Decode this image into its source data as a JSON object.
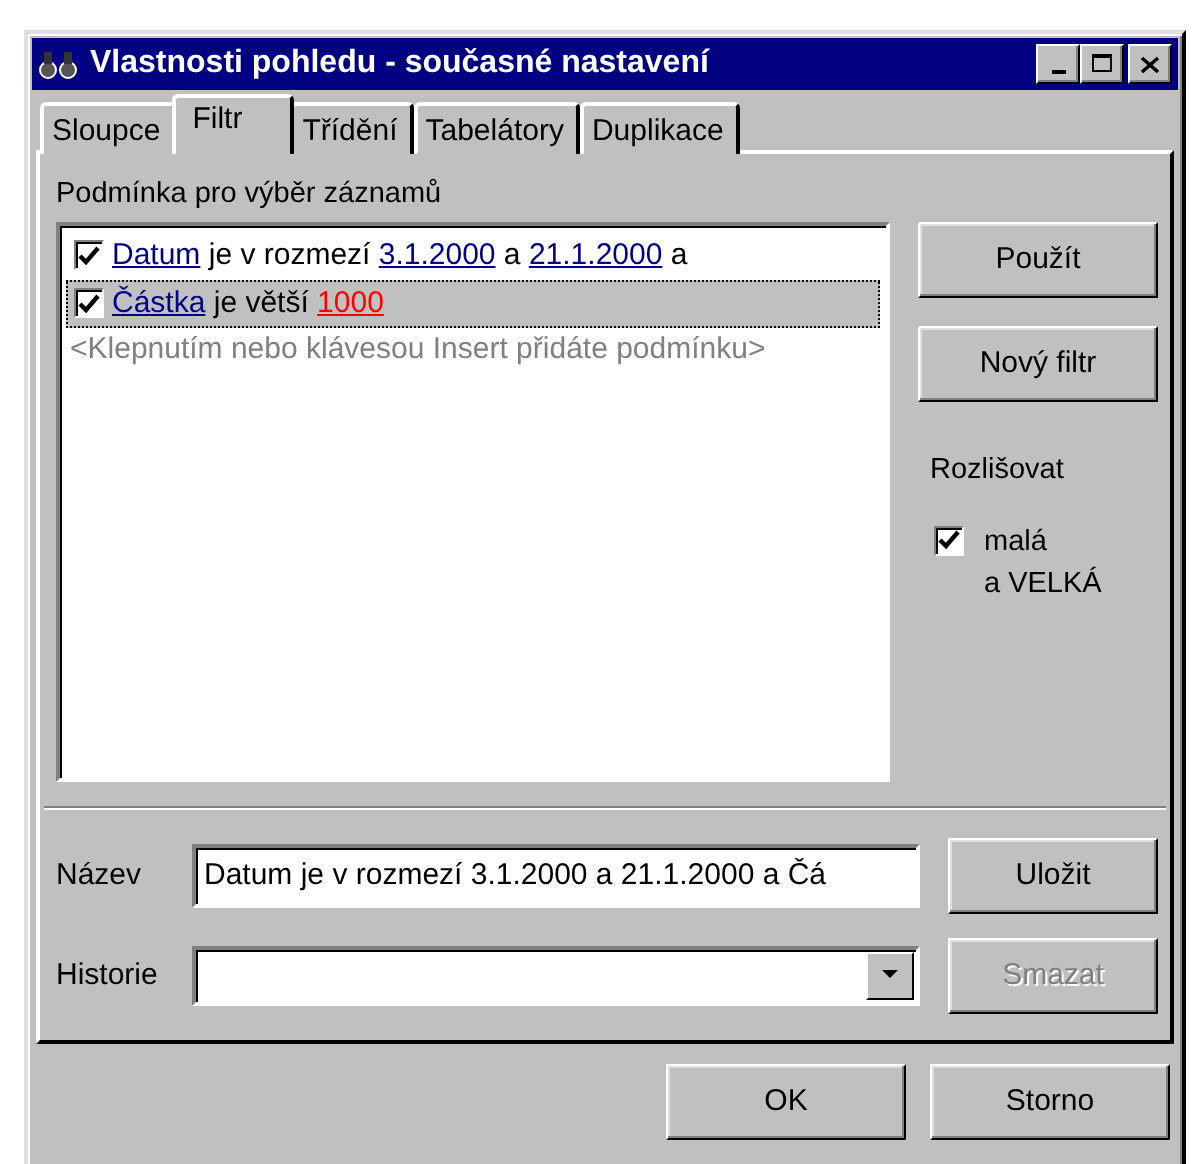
{
  "window": {
    "title": "Vlastnosti pohledu - současné nastavení"
  },
  "tabs": [
    {
      "label": "Sloupce",
      "selected": false
    },
    {
      "label": "Filtr",
      "selected": true
    },
    {
      "label": "Třídění",
      "selected": false
    },
    {
      "label": "Tabelátory",
      "selected": false
    },
    {
      "label": "Duplikace",
      "selected": false
    }
  ],
  "conditions": {
    "label": "Podmínka pro výběr záznamů",
    "rows": [
      {
        "checked": true,
        "selected": false,
        "parts": [
          {
            "kind": "field",
            "text": "Datum"
          },
          {
            "kind": "plain",
            "text": " je v rozmezí "
          },
          {
            "kind": "value",
            "text": "3.1.2000"
          },
          {
            "kind": "plain",
            "text": " a "
          },
          {
            "kind": "value",
            "text": "21.1.2000"
          },
          {
            "kind": "plain",
            "text": " a"
          }
        ]
      },
      {
        "checked": true,
        "selected": true,
        "parts": [
          {
            "kind": "field",
            "text": "Částka"
          },
          {
            "kind": "plain",
            "text": " je větší "
          },
          {
            "kind": "number",
            "text": "1000"
          }
        ]
      }
    ],
    "hint": "<Klepnutím nebo klávesou Insert přidáte podmínku>"
  },
  "side_buttons": [
    {
      "label": "Použít",
      "disabled": false
    },
    {
      "label": "Nový filtr",
      "disabled": false
    }
  ],
  "case_group": {
    "label": "Rozlišovat",
    "checkbox": {
      "label_lines": [
        "malá",
        "a VELKÁ"
      ],
      "checked": true
    }
  },
  "name_field": {
    "label": "Název",
    "value": "Datum je v rozmezí 3.1.2000 a 21.1.2000 a Čá"
  },
  "name_button": {
    "label": "Uložit",
    "disabled": false
  },
  "history_field": {
    "label": "Historie"
  },
  "history_button": {
    "label": "Smazat",
    "disabled": true
  },
  "buttons": [
    {
      "label": "OK"
    },
    {
      "label": "Storno"
    }
  ]
}
